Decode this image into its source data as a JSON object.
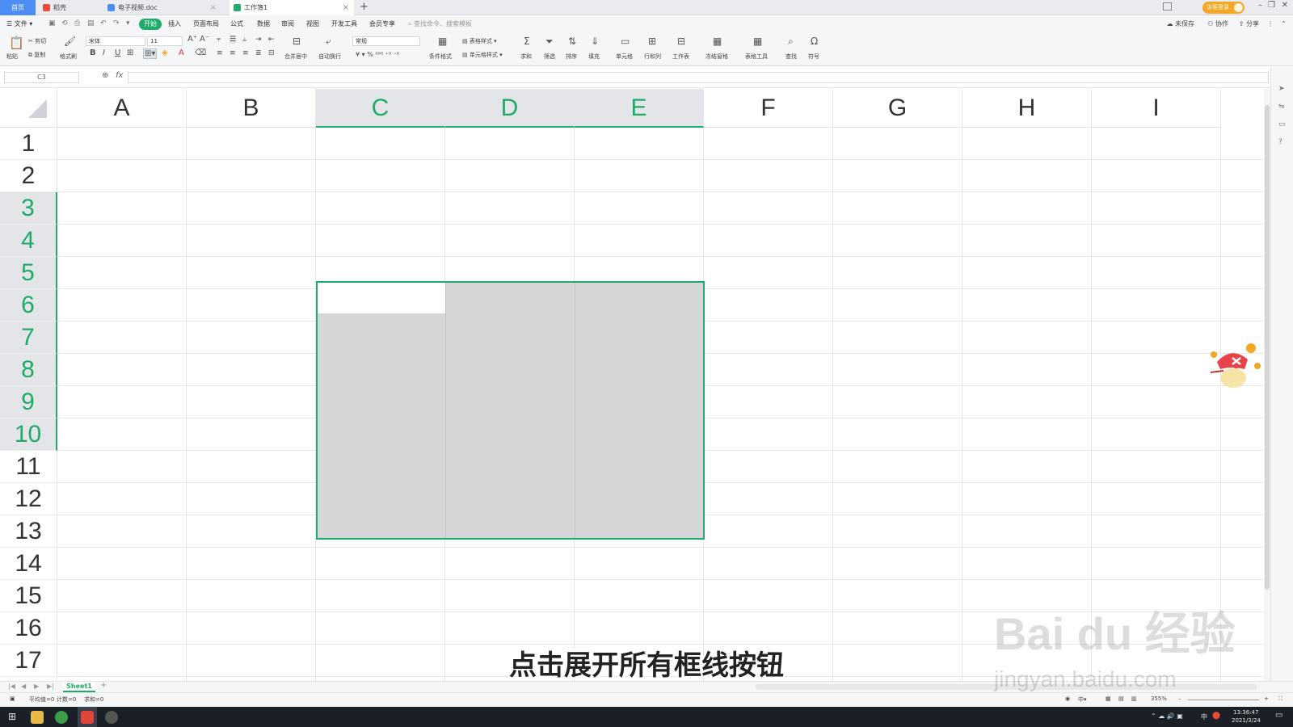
{
  "tabs": [
    {
      "label": "首页"
    },
    {
      "label": "稻壳"
    },
    {
      "label": "电子视频.doc"
    },
    {
      "label": "工作簿1"
    }
  ],
  "header": {
    "login_label": "访客登录"
  },
  "menu": {
    "file_label": "文件",
    "items": [
      "开始",
      "插入",
      "页面布局",
      "公式",
      "数据",
      "审阅",
      "视图",
      "开发工具",
      "会员专享"
    ],
    "search_placeholder": "查找命令、搜索模板",
    "unsaved_label": "未保存",
    "collab_label": "协作",
    "share_label": "分享"
  },
  "ribbon": {
    "paste": "粘贴",
    "cut": "剪切",
    "copy": "复制",
    "format_painter": "格式刷",
    "font_name": "宋体",
    "font_size": "11",
    "merge_center": "合并居中",
    "wrap_text": "自动换行",
    "number_format": "常规",
    "conditional_format": "条件格式",
    "table_style": "表格样式",
    "cell_style": "单元格样式",
    "sum": "求和",
    "filter": "筛选",
    "sort": "排序",
    "fill": "填充",
    "cell": "单元格",
    "row_col": "行和列",
    "worksheet": "工作表",
    "freeze": "冻结窗格",
    "table_tools": "表格工具",
    "find": "查找",
    "symbol": "符号"
  },
  "formula_bar": {
    "name_box": "C3",
    "fx_label": "fx",
    "formula": ""
  },
  "grid": {
    "columns": [
      "A",
      "B",
      "C",
      "D",
      "E",
      "F",
      "G",
      "H",
      "I"
    ],
    "selected_columns": [
      "C",
      "D",
      "E"
    ],
    "rows": [
      "1",
      "2",
      "3",
      "4",
      "5",
      "6",
      "7",
      "8",
      "9",
      "10",
      "11",
      "12",
      "13",
      "14",
      "15",
      "16",
      "17"
    ],
    "selected_rows": [
      "3",
      "4",
      "5",
      "6",
      "7",
      "8",
      "9",
      "10"
    ],
    "selection_range": "C3:E10",
    "selection_color": "#d6d6d6",
    "accent_color": "#1fab6a"
  },
  "sheets": [
    {
      "name": "Sheet1"
    }
  ],
  "status": {
    "average": "平均值=0",
    "count": "计数=0",
    "sum": "求和=0",
    "zoom": "355%"
  },
  "taskbar": {
    "time": "13:36:47",
    "date": "2021/3/24",
    "ime": "中"
  },
  "subtitle": "点击展开所有框线按钮",
  "watermark": {
    "logo": "Bai du 经验",
    "url": "jingyan.baidu.com"
  }
}
